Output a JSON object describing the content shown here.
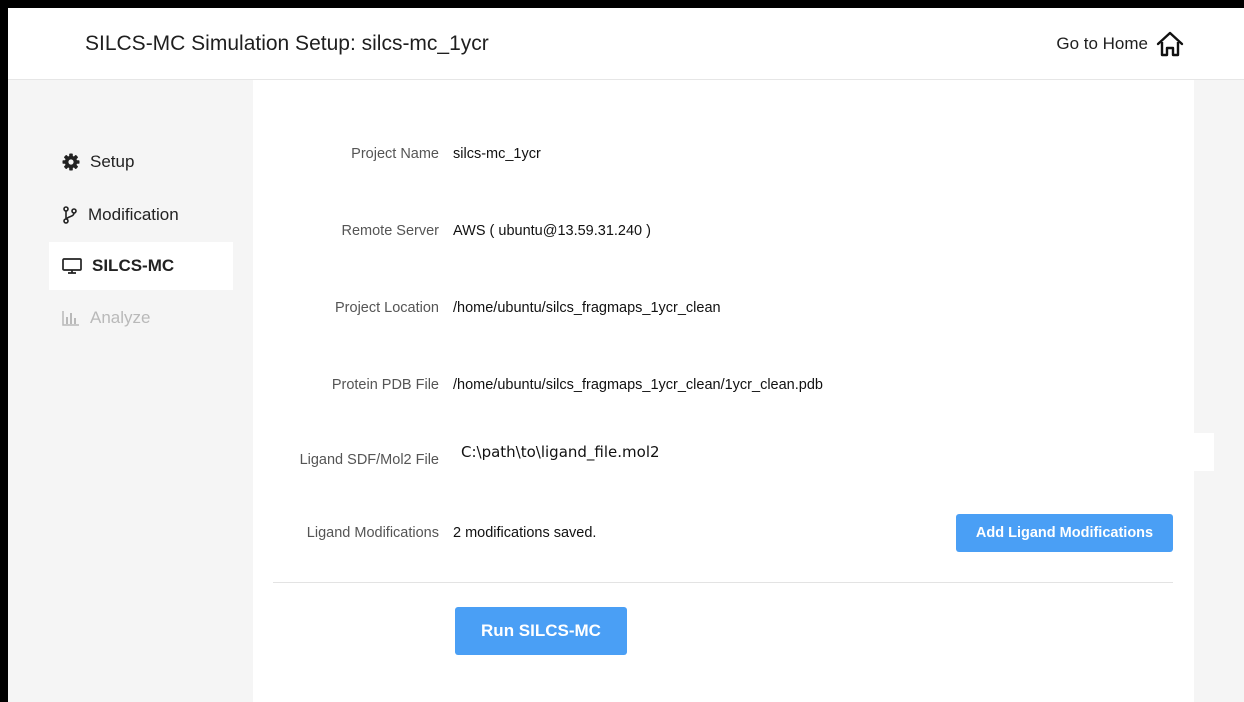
{
  "header": {
    "title": "SILCS-MC Simulation Setup: silcs-mc_1ycr",
    "home_label": "Go to Home",
    "home_icon": "home-icon"
  },
  "sidebar": {
    "items": [
      {
        "label": "Setup",
        "icon": "gear-icon",
        "state": "normal"
      },
      {
        "label": "Modification",
        "icon": "branch-icon",
        "state": "normal"
      },
      {
        "label": "SILCS-MC",
        "icon": "monitor-icon",
        "state": "active"
      },
      {
        "label": "Analyze",
        "icon": "bar-chart-icon",
        "state": "disabled"
      }
    ]
  },
  "form": {
    "project_name_label": "Project Name",
    "project_name_value": "silcs-mc_1ycr",
    "remote_server_label": "Remote Server",
    "remote_server_value": "AWS ( ubuntu@13.59.31.240 )",
    "project_location_label": "Project Location",
    "project_location_value": "/home/ubuntu/silcs_fragmaps_1ycr_clean",
    "protein_pdb_label": "Protein PDB File",
    "protein_pdb_value": "/home/ubuntu/silcs_fragmaps_1ycr_clean/1ycr_clean.pdb",
    "ligand_file_label": "Ligand SDF/Mol2 File",
    "ligand_file_value": "C:\\path\\to\\ligand_file.mol2",
    "ligand_mods_label": "Ligand Modifications",
    "ligand_mods_value": "2 modifications saved."
  },
  "buttons": {
    "add_ligand_mods": "Add Ligand Modifications",
    "run": "Run SILCS-MC"
  },
  "colors": {
    "accent": "#4a9ff5",
    "sidebar_bg": "#f5f5f5",
    "disabled_text": "#b9b9b9"
  }
}
